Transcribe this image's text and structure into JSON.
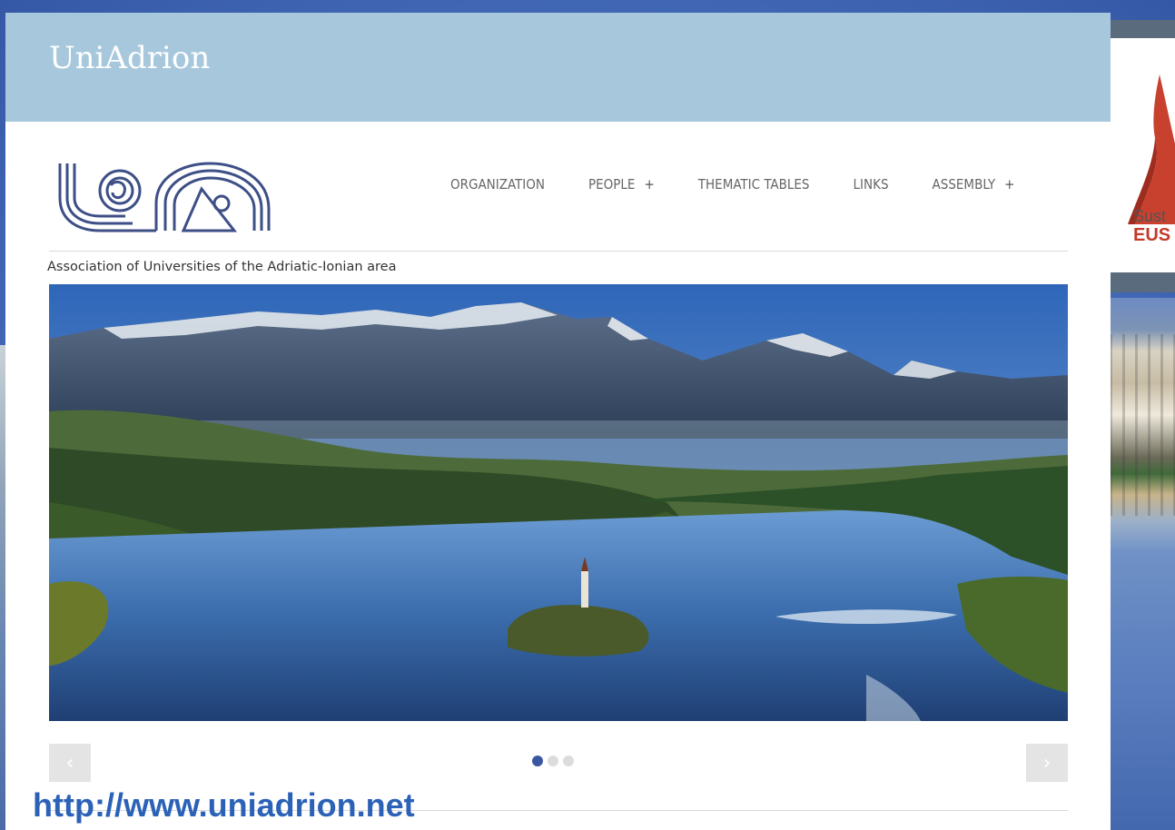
{
  "site": {
    "title": "UniAdrion",
    "tagline": "Association of Universities of the Adriatic-Ionian area",
    "nav": [
      {
        "label": "ORGANIZATION",
        "has_submenu": false
      },
      {
        "label": "PEOPLE",
        "has_submenu": true
      },
      {
        "label": "THEMATIC TABLES",
        "has_submenu": false
      },
      {
        "label": "LINKS",
        "has_submenu": false
      },
      {
        "label": "ASSEMBLY",
        "has_submenu": true
      }
    ],
    "submenu_symbol": "+"
  },
  "slider": {
    "prev_symbol": "‹",
    "next_symbol": "›",
    "slide_count": 3,
    "active_slide": 1
  },
  "side_panel": {
    "subtitle_fragment": "Sust",
    "acronym_fragment": "EUS"
  },
  "caption": {
    "url": "http://www.uniadrion.net"
  },
  "colors": {
    "header_bg": "#a7c8dc",
    "active_dot": "#3a57a0",
    "caption": "#2b62b8",
    "eusair_red": "#c43b2a"
  }
}
